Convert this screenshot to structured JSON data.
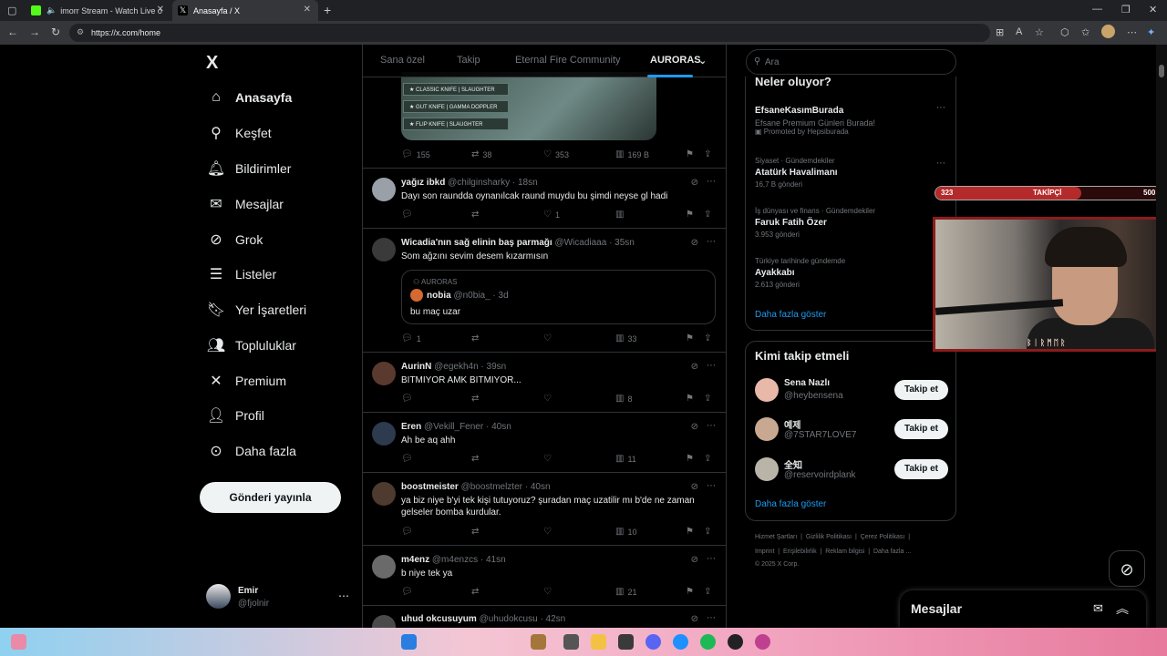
{
  "browser": {
    "tabs": [
      {
        "label": "imorr Stream - Watch Live o"
      },
      {
        "label": "Anasayfa / X"
      }
    ],
    "url": "https://x.com/home"
  },
  "nav": {
    "logo": "X",
    "items": [
      {
        "label": "Anasayfa",
        "icon": "home-icon"
      },
      {
        "label": "Keşfet",
        "icon": "search-icon"
      },
      {
        "label": "Bildirimler",
        "icon": "bell-icon"
      },
      {
        "label": "Mesajlar",
        "icon": "mail-icon"
      },
      {
        "label": "Grok",
        "icon": "grok-icon"
      },
      {
        "label": "Listeler",
        "icon": "list-icon"
      },
      {
        "label": "Yer İşaretleri",
        "icon": "bookmark-icon"
      },
      {
        "label": "Topluluklar",
        "icon": "communities-icon"
      },
      {
        "label": "Premium",
        "icon": "x-icon"
      },
      {
        "label": "Profil",
        "icon": "profile-icon"
      },
      {
        "label": "Daha fazla",
        "icon": "more-icon"
      }
    ],
    "post_button": "Gönderi yayınla",
    "account": {
      "name": "Emir",
      "handle": "@fjolnir"
    }
  },
  "feed_tabs": {
    "t1": "Sana özel",
    "t2": "Takip",
    "t3": "Eternal Fire Community",
    "t4": "AURORAS"
  },
  "top_post": {
    "media_lines": [
      "★ CLASSIC KNIFE | SLAUGHTER",
      "★ GUT KNIFE | GAMMA DOPPLER",
      "★ FLIP KNIFE | SLAUGHTER"
    ],
    "replies": "155",
    "reposts": "38",
    "likes": "353",
    "views": "169 B"
  },
  "posts": [
    {
      "name": "yağız ibkd",
      "handle": "@chilginsharky · 18sn",
      "text": "Dayı son raundda oynanılcak raund muydu bu şimdi neyse gl hadi",
      "replies": "",
      "reposts": "",
      "likes": "1",
      "views": ""
    },
    {
      "name": "Wicadia'nın sağ elinin baş parmağı",
      "handle": "@Wicadiaaa · 35sn",
      "text": "Som ağzını sevim desem kızarmısın",
      "quote": {
        "community": "AURORAS",
        "name": "nobia",
        "handle": "@n0bia_ · 3d",
        "text": "bu maç uzar"
      },
      "replies": "1",
      "reposts": "",
      "likes": "",
      "views": "33"
    },
    {
      "name": "AurinN",
      "handle": "@egekh4n · 39sn",
      "text": "BITMIYOR AMK BITMIYOR...",
      "replies": "",
      "reposts": "",
      "likes": "",
      "views": "8"
    },
    {
      "name": "Eren",
      "handle": "@Vekill_Fener · 40sn",
      "text": "Ah be aq ahh",
      "replies": "",
      "reposts": "",
      "likes": "",
      "views": "11"
    },
    {
      "name": "boostmeister",
      "handle": "@boostmelzter · 40sn",
      "text": "ya biz niye b'yi tek kişi tutuyoruz? şuradan maç uzatilir mı b'de ne zaman gelseler bomba kurdular.",
      "replies": "",
      "reposts": "",
      "likes": "",
      "views": "10"
    },
    {
      "name": "m4enz",
      "handle": "@m4enzcs · 41sn",
      "text": "b niye tek ya",
      "replies": "",
      "reposts": "",
      "likes": "",
      "views": "21"
    },
    {
      "name": "uhud okcusuyum",
      "handle": "@uhudokcusu · 42sn",
      "text": "",
      "replies": "",
      "reposts": "",
      "likes": "",
      "views": ""
    }
  ],
  "search": {
    "placeholder": "Ara"
  },
  "trends": {
    "title": "Neler oluyor?",
    "items": [
      {
        "context": "",
        "name": "EfsaneKasımBurada",
        "sub": "Efsane Premium Günleri Burada!",
        "promo": "Promoted by Hepsiburada"
      },
      {
        "context": "Siyaset · Gündemdekiler",
        "name": "Atatürk Havalimanı",
        "sub": "16,7 B gönderi"
      },
      {
        "context": "İş dünyası ve finans · Gündemdekiler",
        "name": "Faruk Fatih Özer",
        "sub": "3.953 gönderi"
      },
      {
        "context": "Türkiye tarihinde gündemde",
        "name": "Ayakkabı",
        "sub": "2.613 gönderi"
      }
    ],
    "show_more": "Daha fazla göster"
  },
  "who_to_follow": {
    "title": "Kimi takip etmeli",
    "items": [
      {
        "name": "Sena Nazlı",
        "handle": "@heybensena",
        "button": "Takip et"
      },
      {
        "name": "예제",
        "handle": "@7STAR7LOVE7",
        "button": "Takip et"
      },
      {
        "name": "全知",
        "handle": "@reservoirdplank",
        "button": "Takip et"
      }
    ],
    "show_more": "Daha fazla göster"
  },
  "footer": {
    "row1": [
      "Hizmet Şartları",
      "Gizlilik Politikası",
      "Çerez Politikası"
    ],
    "row2": [
      "Imprint",
      "Erişilebilirlik",
      "Reklam bilgisi",
      "Daha fazla ..."
    ],
    "copy": "© 2025 X Corp."
  },
  "overlay": {
    "left": "323",
    "label": "TAKİPÇİ",
    "right": "500",
    "progress": 0.646,
    "cam_plate": "ᛒᛁᚱᛗᛖᚱ"
  },
  "messages": {
    "title": "Mesajlar"
  },
  "colors": {
    "accent": "#1d9bf0",
    "bg": "#000000",
    "border": "#2f3336",
    "muted": "#71767b"
  }
}
